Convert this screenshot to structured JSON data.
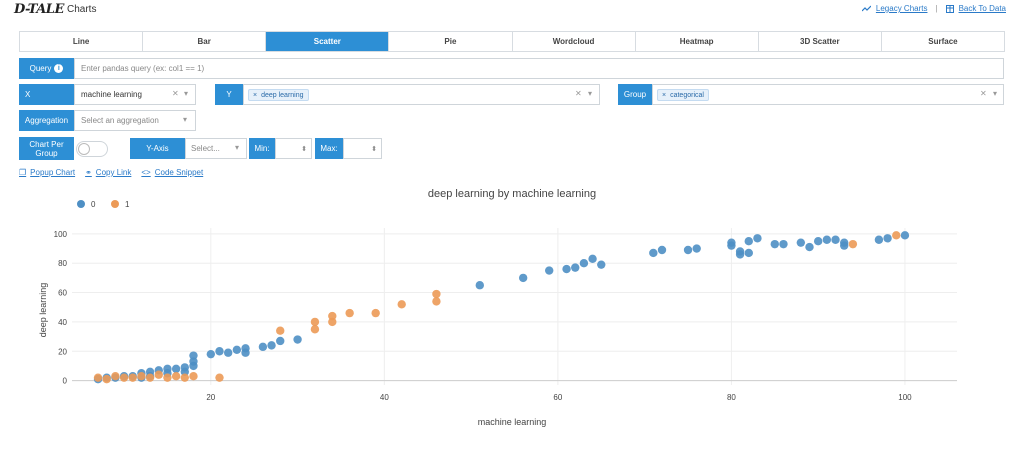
{
  "header": {
    "logo": "D-TALE",
    "title": "Charts",
    "legacy_charts": "Legacy Charts",
    "back_to_data": "Back To Data"
  },
  "tabs": [
    "Line",
    "Bar",
    "Scatter",
    "Pie",
    "Wordcloud",
    "Heatmap",
    "3D Scatter",
    "Surface"
  ],
  "active_tab": "Scatter",
  "query": {
    "label": "Query",
    "placeholder": "Enter pandas query (ex: col1 == 1)"
  },
  "x": {
    "label": "X",
    "value": "machine learning"
  },
  "y": {
    "label": "Y",
    "chip": "deep learning"
  },
  "group": {
    "label": "Group",
    "chip": "categorical"
  },
  "aggregation": {
    "label": "Aggregation",
    "placeholder": "Select an aggregation"
  },
  "chart_per_group": {
    "label": "Chart Per Group"
  },
  "y_axis": {
    "label": "Y-Axis",
    "placeholder": "Select...",
    "min_label": "Min:",
    "max_label": "Max:"
  },
  "links": {
    "popup": "Popup Chart",
    "copy": "Copy Link",
    "code": "Code Snippet"
  },
  "colors": {
    "accent": "#2d8fd5",
    "series0": "#4e8fc4",
    "series1": "#ec9a57"
  },
  "chart_data": {
    "type": "scatter",
    "title": "deep learning by machine learning",
    "xlabel": "machine learning",
    "ylabel": "deep learning",
    "xlim": [
      4,
      106
    ],
    "ylim": [
      -3,
      104
    ],
    "xticks": [
      20,
      40,
      60,
      80,
      100
    ],
    "yticks": [
      0,
      20,
      40,
      60,
      80,
      100
    ],
    "grid": true,
    "legend": "top-left",
    "series": [
      {
        "name": "0",
        "color": "#4e8fc4",
        "points": [
          [
            7,
            1
          ],
          [
            8,
            2
          ],
          [
            9,
            2
          ],
          [
            10,
            3
          ],
          [
            11,
            3
          ],
          [
            12,
            5
          ],
          [
            12,
            2
          ],
          [
            13,
            6
          ],
          [
            13,
            3
          ],
          [
            14,
            7
          ],
          [
            15,
            8
          ],
          [
            15,
            5
          ],
          [
            16,
            8
          ],
          [
            17,
            9
          ],
          [
            17,
            6
          ],
          [
            18,
            10
          ],
          [
            18,
            13
          ],
          [
            18,
            17
          ],
          [
            20,
            18
          ],
          [
            21,
            20
          ],
          [
            22,
            19
          ],
          [
            23,
            21
          ],
          [
            24,
            22
          ],
          [
            24,
            19
          ],
          [
            26,
            23
          ],
          [
            27,
            24
          ],
          [
            28,
            27
          ],
          [
            30,
            28
          ],
          [
            51,
            65
          ],
          [
            56,
            70
          ],
          [
            59,
            75
          ],
          [
            61,
            76
          ],
          [
            62,
            77
          ],
          [
            63,
            80
          ],
          [
            64,
            83
          ],
          [
            65,
            79
          ],
          [
            71,
            87
          ],
          [
            72,
            89
          ],
          [
            75,
            89
          ],
          [
            76,
            90
          ],
          [
            80,
            92
          ],
          [
            80,
            94
          ],
          [
            81,
            88
          ],
          [
            81,
            86
          ],
          [
            82,
            87
          ],
          [
            82,
            95
          ],
          [
            83,
            97
          ],
          [
            85,
            93
          ],
          [
            86,
            93
          ],
          [
            88,
            94
          ],
          [
            89,
            91
          ],
          [
            90,
            95
          ],
          [
            91,
            96
          ],
          [
            92,
            96
          ],
          [
            93,
            94
          ],
          [
            93,
            92
          ],
          [
            97,
            96
          ],
          [
            98,
            97
          ],
          [
            100,
            99
          ]
        ]
      },
      {
        "name": "1",
        "color": "#ec9a57",
        "points": [
          [
            7,
            2
          ],
          [
            8,
            1
          ],
          [
            9,
            3
          ],
          [
            10,
            2
          ],
          [
            11,
            2
          ],
          [
            12,
            3
          ],
          [
            13,
            2
          ],
          [
            14,
            4
          ],
          [
            15,
            2
          ],
          [
            16,
            3
          ],
          [
            17,
            2
          ],
          [
            18,
            3
          ],
          [
            21,
            2
          ],
          [
            28,
            34
          ],
          [
            32,
            35
          ],
          [
            32,
            40
          ],
          [
            34,
            40
          ],
          [
            34,
            44
          ],
          [
            36,
            46
          ],
          [
            39,
            46
          ],
          [
            42,
            52
          ],
          [
            46,
            54
          ],
          [
            46,
            59
          ],
          [
            94,
            93
          ],
          [
            99,
            99
          ]
        ]
      }
    ]
  }
}
